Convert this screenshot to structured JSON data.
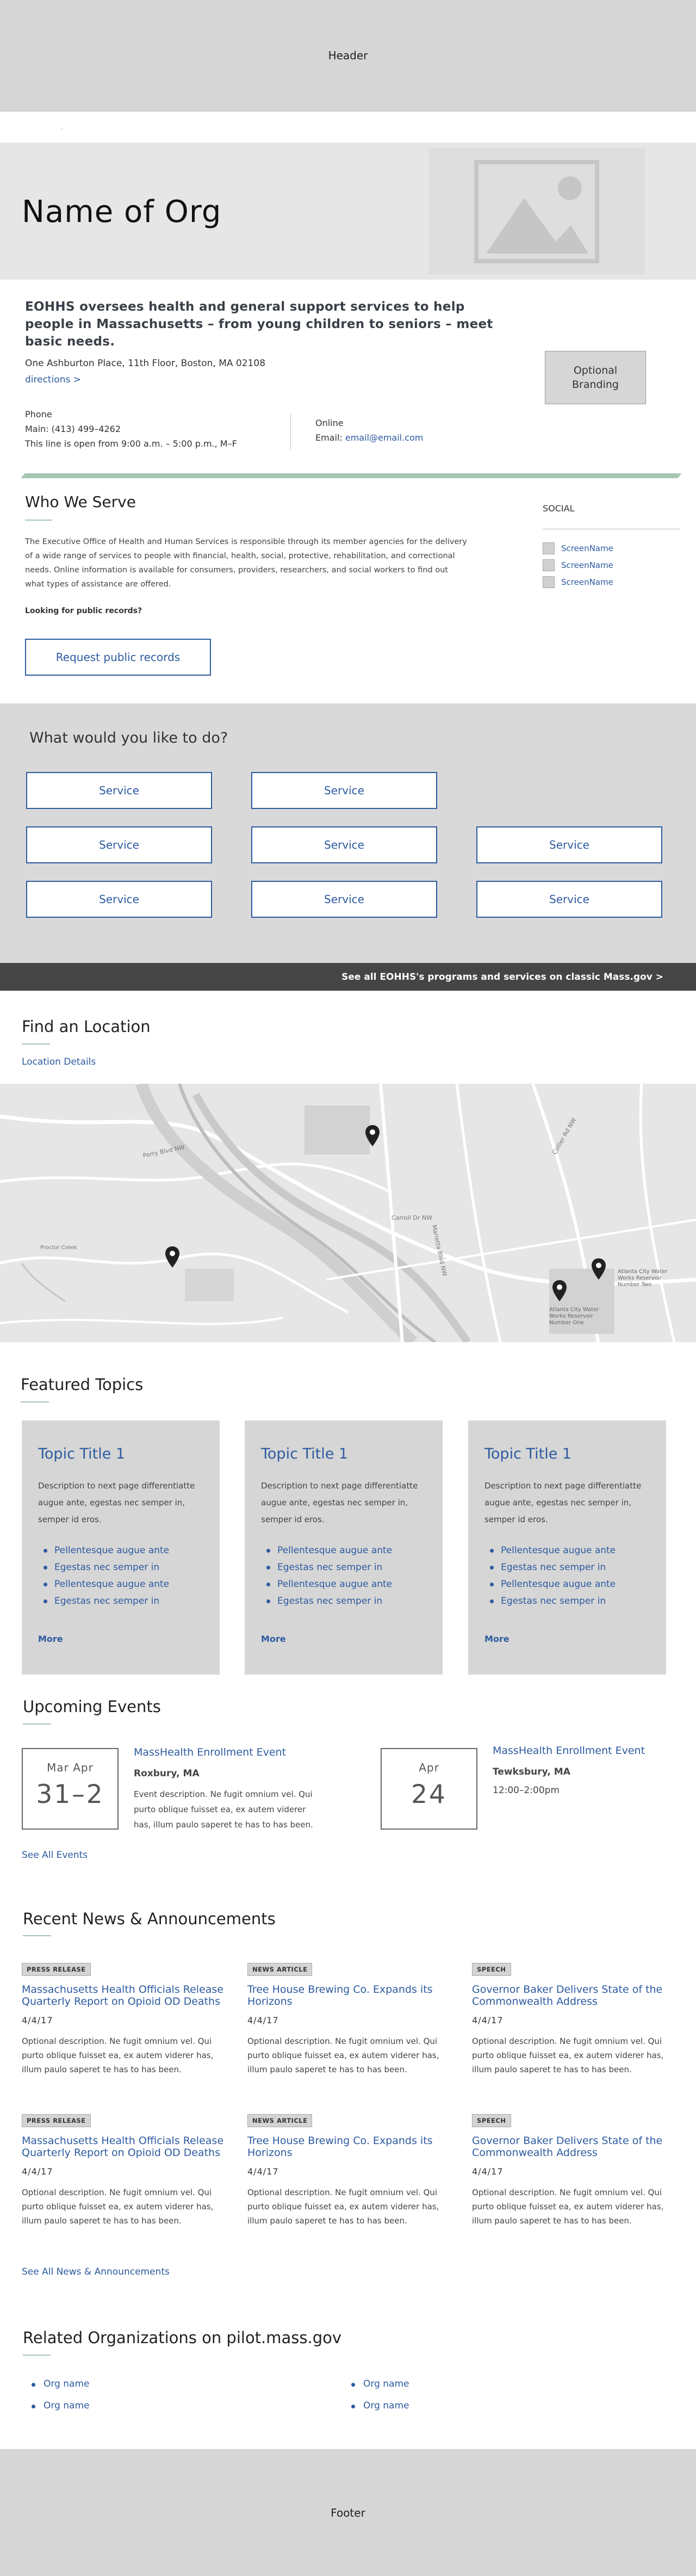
{
  "header": {
    "label": "Header"
  },
  "breadcrumb": {
    "text": "·"
  },
  "banner": {
    "org_name": "Name of Org"
  },
  "intro": {
    "title": "EOHHS oversees health and general support services to help people in Massachusetts – from young children to seniors – meet basic needs.",
    "address": "One Ashburton Place, 11th Floor, Boston, MA 02108",
    "directions": "directions >",
    "optional_branding": "Optional Branding",
    "phone_label": "Phone",
    "phone_main": "Main: (413) 499–4262",
    "phone_hours": "This line is open from 9:00 a.m. – 5:00 p.m., M–F",
    "online_label": "Online",
    "email_label": "Email: ",
    "email": "email@email.com"
  },
  "who_we_serve": {
    "title": "Who We Serve",
    "paragraph": "The Executive Office of Health and Human Services is responsible through its member agencies for the delivery of a wide range of services to people with financial, health, social, protective, rehabilitation, and correctional needs. Online information is available for consumers, providers, researchers, and social workers to find out what types of assistance are offered.",
    "looking": "Looking for public records?",
    "request_button": "Request public records"
  },
  "social": {
    "title": "SOCIAL",
    "items": [
      "ScreenName",
      "ScreenName",
      "ScreenName"
    ]
  },
  "services": {
    "title": "What would you like to do?",
    "buttons": [
      "Service",
      "Service",
      "Service",
      "Service",
      "Service",
      "Service",
      "Service",
      "Service"
    ],
    "see_all": "See all EOHHS's programs and services on classic Mass.gov >"
  },
  "location": {
    "title": "Find an Location",
    "details_link": "Location Details",
    "map_labels": [
      "Carroll Dr NW",
      "Perry Blvd NW",
      "Marietta Blvd NW",
      "Atlanta City Water Works Reservoir Number Two",
      "Atlanta City Water Works Reservoir Number One",
      "Proctor Creek",
      "Collier Rd NW"
    ]
  },
  "topics": {
    "title": "Featured Topics",
    "cards": [
      {
        "title": "Topic Title 1",
        "desc": "Description to next page differentiatte augue ante, egestas nec semper in, semper id eros.",
        "links": [
          "Pellentesque augue ante",
          "Egestas nec semper in",
          "Pellentesque augue ante",
          "Egestas nec semper in"
        ],
        "more": "More"
      },
      {
        "title": "Topic Title 1",
        "desc": "Description to next page differentiatte augue ante, egestas nec semper in, semper id eros.",
        "links": [
          "Pellentesque augue ante",
          "Egestas nec semper in",
          "Pellentesque augue ante",
          "Egestas nec semper in"
        ],
        "more": "More"
      },
      {
        "title": "Topic Title 1",
        "desc": "Description to next page differentiatte augue ante, egestas nec semper in, semper id eros.",
        "links": [
          "Pellentesque augue ante",
          "Egestas nec semper in",
          "Pellentesque augue ante",
          "Egestas nec semper in"
        ],
        "more": "More"
      }
    ]
  },
  "events": {
    "title": "Upcoming Events",
    "items": [
      {
        "month": "Mar  Apr",
        "day": "31–2",
        "title": "MassHealth Enrollment Event",
        "location": "Roxbury, MA",
        "desc": "Event description. Ne fugit omnium vel. Qui purto oblique fuisset ea, ex autem viderer has, illum paulo saperet te has to has been."
      },
      {
        "month": "Apr",
        "day": "24",
        "title": "MassHealth Enrollment Event",
        "location": "Tewksbury, MA",
        "time": "12:00–2:00pm"
      }
    ],
    "see_all": "See All Events"
  },
  "news": {
    "title": "Recent News & Announcements",
    "items": [
      {
        "tag": "PRESS RELEASE",
        "title": "Massachusetts Health Officials Release Quarterly Report on Opioid OD Deaths",
        "date": "4/4/17",
        "desc": "Optional description. Ne fugit omnium vel. Qui purto oblique fuisset ea, ex autem viderer has, illum paulo saperet te has to has been."
      },
      {
        "tag": "NEWS ARTICLE",
        "title": "Tree House Brewing Co. Expands its Horizons",
        "date": "4/4/17",
        "desc": "Optional description. Ne fugit omnium vel. Qui purto oblique fuisset ea, ex autem viderer has, illum paulo saperet te has to has been."
      },
      {
        "tag": "SPEECH",
        "title": "Governor Baker Delivers State of the Commonwealth Address",
        "date": "4/4/17",
        "desc": "Optional description. Ne fugit omnium vel. Qui purto oblique fuisset ea, ex autem viderer has, illum paulo saperet te has to has been."
      },
      {
        "tag": "PRESS RELEASE",
        "title": "Massachusetts Health Officials Release Quarterly Report on Opioid OD Deaths",
        "date": "4/4/17",
        "desc": "Optional description. Ne fugit omnium vel. Qui purto oblique fuisset ea, ex autem viderer has, illum paulo saperet te has to has been."
      },
      {
        "tag": "NEWS ARTICLE",
        "title": "Tree House Brewing Co. Expands its Horizons",
        "date": "4/4/17",
        "desc": "Optional description. Ne fugit omnium vel. Qui purto oblique fuisset ea, ex autem viderer has, illum paulo saperet te has to has been."
      },
      {
        "tag": "SPEECH",
        "title": "Governor Baker Delivers State of the Commonwealth Address",
        "date": "4/4/17",
        "desc": "Optional description. Ne fugit omnium vel. Qui purto oblique fuisset ea, ex autem viderer has, illum paulo saperet te has to has been."
      }
    ],
    "see_all": "See All News & Announcements"
  },
  "related": {
    "title": "Related Organizations on pilot.mass.gov",
    "orgs": [
      "Org name",
      "Org name",
      "Org name",
      "Org name"
    ]
  },
  "footer": {
    "label": "Footer"
  },
  "colors": {
    "accent": "#2d5aa0",
    "rule": "#a6c6b4",
    "panel": "#d6d6d6",
    "bar": "#454545"
  }
}
